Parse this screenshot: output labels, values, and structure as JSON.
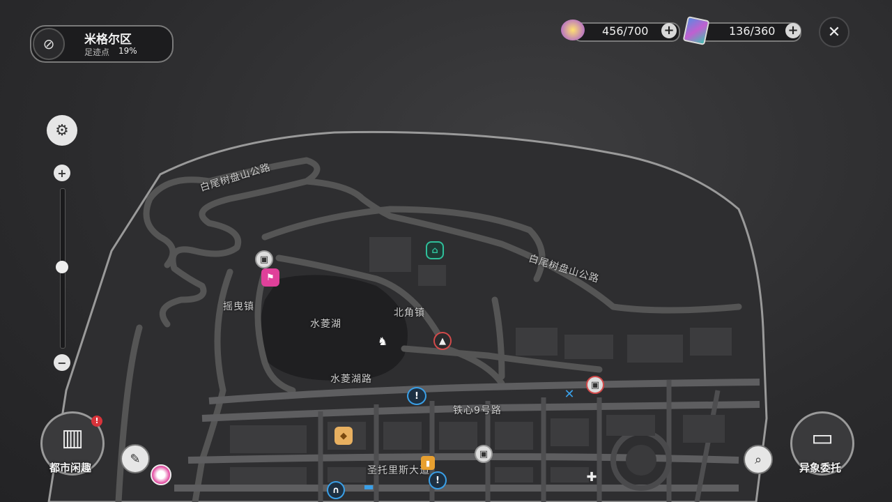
{
  "region": {
    "name": "米格尔区",
    "progress_label": "足迹点",
    "progress_value": "19%"
  },
  "resources": {
    "energy": {
      "value": "456/700",
      "icon": "energy-crystal-icon"
    },
    "cards": {
      "value": "136/360",
      "icon": "card-pack-icon"
    }
  },
  "map_labels": {
    "road_top_left": "白尾树盘山公路",
    "road_top_right": "白尾树盘山公路",
    "town_west": "摇曳镇",
    "town_north": "北角镇",
    "lake": "水菱湖",
    "lake_road": "水菱湖路",
    "road_iron": "铁心9号路",
    "avenue": "圣托里斯大道"
  },
  "buttons": {
    "city_fun": "都市闲趣",
    "anomaly": "异象委托"
  },
  "colors": {
    "accent_pink": "#e0409a",
    "accent_teal": "#2fbf9a",
    "accent_blue": "#3aa0e8",
    "accent_red": "#d24a4a",
    "accent_orange": "#e8a030"
  }
}
